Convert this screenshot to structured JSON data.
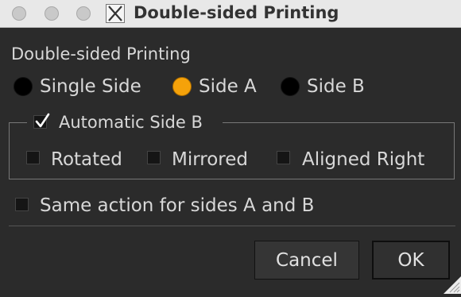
{
  "window": {
    "title": "Double-sided Printing"
  },
  "dialog": {
    "heading": "Double-sided Printing",
    "radio_options": [
      {
        "label": "Single Side",
        "selected": false
      },
      {
        "label": "Side A",
        "selected": true
      },
      {
        "label": "Side B",
        "selected": false
      }
    ],
    "group": {
      "title": "Automatic Side B",
      "checked": true,
      "options": [
        {
          "label": "Rotated",
          "checked": false
        },
        {
          "label": "Mirrored",
          "checked": false
        },
        {
          "label": "Aligned Right",
          "checked": false
        }
      ]
    },
    "same_action": {
      "label": "Same action for sides A and B",
      "checked": false
    },
    "buttons": {
      "cancel": "Cancel",
      "ok": "OK"
    }
  },
  "colors": {
    "selected_radio": "#f5a20a",
    "background": "#2b2b2b",
    "text": "#d8d8d8"
  }
}
